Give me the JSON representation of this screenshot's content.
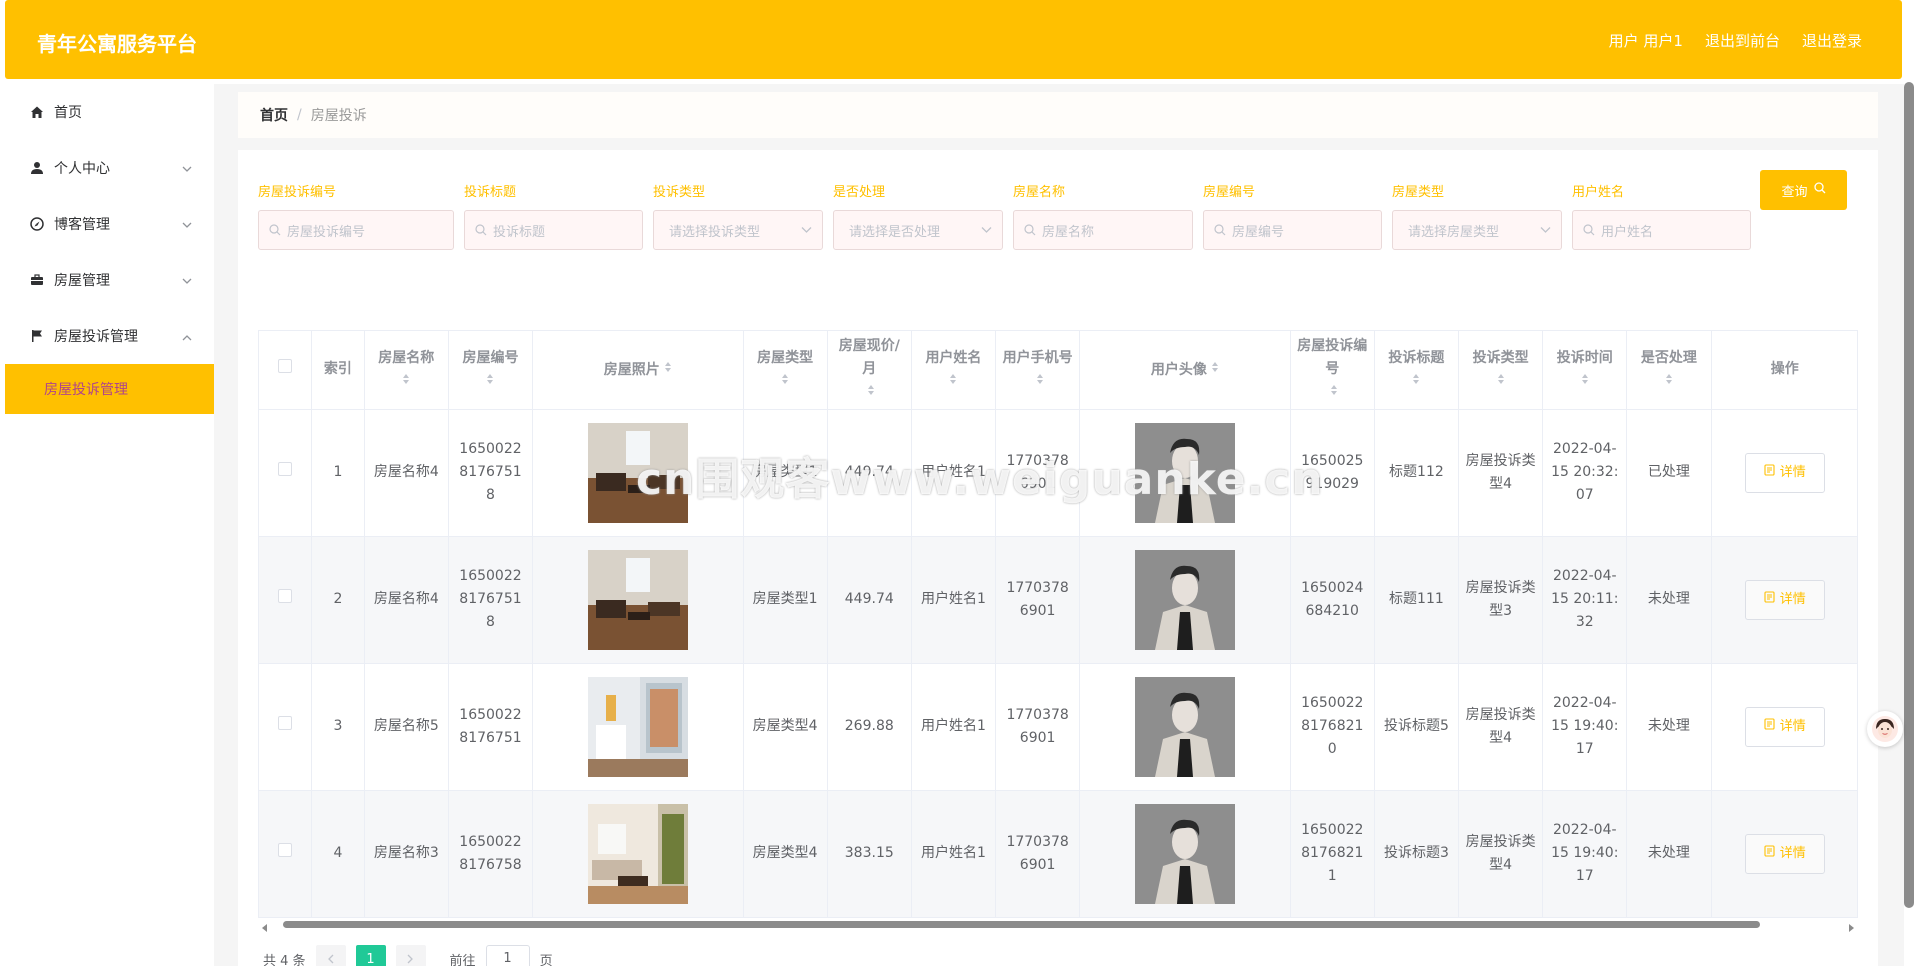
{
  "app": {
    "title": "青年公寓服务平台"
  },
  "header": {
    "user_label": "用户 用户1",
    "to_front": "退出到前台",
    "logout": "退出登录"
  },
  "sidebar": {
    "items": [
      {
        "label": "首页",
        "icon": "home-icon"
      },
      {
        "label": "个人中心",
        "icon": "user-icon"
      },
      {
        "label": "博客管理",
        "icon": "compass-icon"
      },
      {
        "label": "房屋管理",
        "icon": "briefcase-icon"
      },
      {
        "label": "房屋投诉管理",
        "icon": "flag-icon"
      }
    ],
    "submenu": {
      "label": "房屋投诉管理"
    }
  },
  "breadcrumb": {
    "home": "首页",
    "current": "房屋投诉"
  },
  "search": {
    "fields": [
      {
        "label": "房屋投诉编号",
        "placeholder": "房屋投诉编号",
        "kind": "input"
      },
      {
        "label": "投诉标题",
        "placeholder": "投诉标题",
        "kind": "input"
      },
      {
        "label": "投诉类型",
        "placeholder": "请选择投诉类型",
        "kind": "select"
      },
      {
        "label": "是否处理",
        "placeholder": "请选择是否处理",
        "kind": "select"
      },
      {
        "label": "房屋名称",
        "placeholder": "房屋名称",
        "kind": "input"
      },
      {
        "label": "房屋编号",
        "placeholder": "房屋编号",
        "kind": "input"
      },
      {
        "label": "房屋类型",
        "placeholder": "请选择房屋类型",
        "kind": "select"
      },
      {
        "label": "用户姓名",
        "placeholder": "用户姓名",
        "kind": "input"
      }
    ],
    "query_button": "查询"
  },
  "table": {
    "headers": {
      "index": "索引",
      "house_name": "房屋名称",
      "house_no": "房屋编号",
      "house_photo": "房屋照片",
      "house_type": "房屋类型",
      "price": "房屋现价/月",
      "user_name": "用户姓名",
      "user_phone": "用户手机号",
      "user_avatar": "用户头像",
      "complaint_no": "房屋投诉编号",
      "complaint_title": "投诉标题",
      "complaint_type": "投诉类型",
      "complaint_time": "投诉时间",
      "handled": "是否处理",
      "action": "操作"
    },
    "rows": [
      {
        "index": "1",
        "house_name": "房屋名称4",
        "house_no": "16500228176751 8",
        "house_type": "房屋类型1",
        "price": "449.74",
        "user_name": "用户姓名1",
        "user_phone": "17703786901",
        "complaint_no": "1650025919029",
        "complaint_title": "标题112",
        "complaint_type": "房屋投诉类型4",
        "complaint_time": "2022-04-15 20:32:07",
        "handled": "已处理",
        "action": "详情",
        "photo": "room-a"
      },
      {
        "index": "2",
        "house_name": "房屋名称4",
        "house_no": "16500228176751 8",
        "house_type": "房屋类型1",
        "price": "449.74",
        "user_name": "用户姓名1",
        "user_phone": "17703786901",
        "complaint_no": "1650024684210",
        "complaint_title": "标题111",
        "complaint_type": "房屋投诉类型3",
        "complaint_time": "2022-04-15 20:11:32",
        "handled": "未处理",
        "action": "详情",
        "photo": "room-a"
      },
      {
        "index": "3",
        "house_name": "房屋名称5",
        "house_no": "16500228176751",
        "house_type": "房屋类型4",
        "price": "269.88",
        "user_name": "用户姓名1",
        "user_phone": "17703786901",
        "complaint_no": "16500228176821 0",
        "complaint_title": "投诉标题5",
        "complaint_type": "房屋投诉类型4",
        "complaint_time": "2022-04-15 19:40:17",
        "handled": "未处理",
        "action": "详情",
        "photo": "room-b"
      },
      {
        "index": "4",
        "house_name": "房屋名称3",
        "house_no": "16500228176758",
        "house_type": "房屋类型4",
        "price": "383.15",
        "user_name": "用户姓名1",
        "user_phone": "17703786901",
        "complaint_no": "16500228176821 1",
        "complaint_title": "投诉标题3",
        "complaint_type": "房屋投诉类型4",
        "complaint_time": "2022-04-15 19:40:17",
        "handled": "未处理",
        "action": "详情",
        "photo": "room-c"
      }
    ]
  },
  "pagination": {
    "total": "共 4 条",
    "current": "1",
    "goto_prefix": "前往",
    "goto_value": "1",
    "goto_suffix": "页"
  },
  "watermark": "cn围观客www.weiguanke.cn",
  "colors": {
    "accent": "#ffc000",
    "submenu_text": "#b0458a",
    "page_active": "#20c997"
  }
}
